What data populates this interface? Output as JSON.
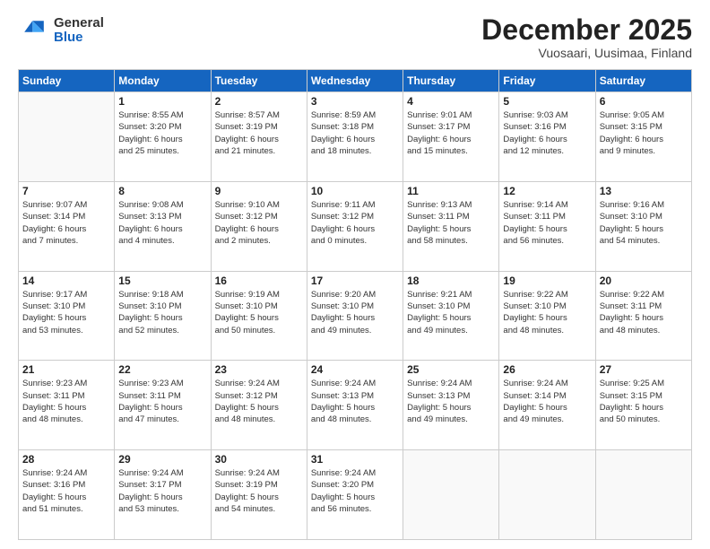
{
  "header": {
    "logo_line1": "General",
    "logo_line2": "Blue",
    "title": "December 2025",
    "subtitle": "Vuosaari, Uusimaa, Finland"
  },
  "weekdays": [
    "Sunday",
    "Monday",
    "Tuesday",
    "Wednesday",
    "Thursday",
    "Friday",
    "Saturday"
  ],
  "weeks": [
    [
      {
        "day": "",
        "info": ""
      },
      {
        "day": "1",
        "info": "Sunrise: 8:55 AM\nSunset: 3:20 PM\nDaylight: 6 hours\nand 25 minutes."
      },
      {
        "day": "2",
        "info": "Sunrise: 8:57 AM\nSunset: 3:19 PM\nDaylight: 6 hours\nand 21 minutes."
      },
      {
        "day": "3",
        "info": "Sunrise: 8:59 AM\nSunset: 3:18 PM\nDaylight: 6 hours\nand 18 minutes."
      },
      {
        "day": "4",
        "info": "Sunrise: 9:01 AM\nSunset: 3:17 PM\nDaylight: 6 hours\nand 15 minutes."
      },
      {
        "day": "5",
        "info": "Sunrise: 9:03 AM\nSunset: 3:16 PM\nDaylight: 6 hours\nand 12 minutes."
      },
      {
        "day": "6",
        "info": "Sunrise: 9:05 AM\nSunset: 3:15 PM\nDaylight: 6 hours\nand 9 minutes."
      }
    ],
    [
      {
        "day": "7",
        "info": "Sunrise: 9:07 AM\nSunset: 3:14 PM\nDaylight: 6 hours\nand 7 minutes."
      },
      {
        "day": "8",
        "info": "Sunrise: 9:08 AM\nSunset: 3:13 PM\nDaylight: 6 hours\nand 4 minutes."
      },
      {
        "day": "9",
        "info": "Sunrise: 9:10 AM\nSunset: 3:12 PM\nDaylight: 6 hours\nand 2 minutes."
      },
      {
        "day": "10",
        "info": "Sunrise: 9:11 AM\nSunset: 3:12 PM\nDaylight: 6 hours\nand 0 minutes."
      },
      {
        "day": "11",
        "info": "Sunrise: 9:13 AM\nSunset: 3:11 PM\nDaylight: 5 hours\nand 58 minutes."
      },
      {
        "day": "12",
        "info": "Sunrise: 9:14 AM\nSunset: 3:11 PM\nDaylight: 5 hours\nand 56 minutes."
      },
      {
        "day": "13",
        "info": "Sunrise: 9:16 AM\nSunset: 3:10 PM\nDaylight: 5 hours\nand 54 minutes."
      }
    ],
    [
      {
        "day": "14",
        "info": "Sunrise: 9:17 AM\nSunset: 3:10 PM\nDaylight: 5 hours\nand 53 minutes."
      },
      {
        "day": "15",
        "info": "Sunrise: 9:18 AM\nSunset: 3:10 PM\nDaylight: 5 hours\nand 52 minutes."
      },
      {
        "day": "16",
        "info": "Sunrise: 9:19 AM\nSunset: 3:10 PM\nDaylight: 5 hours\nand 50 minutes."
      },
      {
        "day": "17",
        "info": "Sunrise: 9:20 AM\nSunset: 3:10 PM\nDaylight: 5 hours\nand 49 minutes."
      },
      {
        "day": "18",
        "info": "Sunrise: 9:21 AM\nSunset: 3:10 PM\nDaylight: 5 hours\nand 49 minutes."
      },
      {
        "day": "19",
        "info": "Sunrise: 9:22 AM\nSunset: 3:10 PM\nDaylight: 5 hours\nand 48 minutes."
      },
      {
        "day": "20",
        "info": "Sunrise: 9:22 AM\nSunset: 3:11 PM\nDaylight: 5 hours\nand 48 minutes."
      }
    ],
    [
      {
        "day": "21",
        "info": "Sunrise: 9:23 AM\nSunset: 3:11 PM\nDaylight: 5 hours\nand 48 minutes."
      },
      {
        "day": "22",
        "info": "Sunrise: 9:23 AM\nSunset: 3:11 PM\nDaylight: 5 hours\nand 47 minutes."
      },
      {
        "day": "23",
        "info": "Sunrise: 9:24 AM\nSunset: 3:12 PM\nDaylight: 5 hours\nand 48 minutes."
      },
      {
        "day": "24",
        "info": "Sunrise: 9:24 AM\nSunset: 3:13 PM\nDaylight: 5 hours\nand 48 minutes."
      },
      {
        "day": "25",
        "info": "Sunrise: 9:24 AM\nSunset: 3:13 PM\nDaylight: 5 hours\nand 49 minutes."
      },
      {
        "day": "26",
        "info": "Sunrise: 9:24 AM\nSunset: 3:14 PM\nDaylight: 5 hours\nand 49 minutes."
      },
      {
        "day": "27",
        "info": "Sunrise: 9:25 AM\nSunset: 3:15 PM\nDaylight: 5 hours\nand 50 minutes."
      }
    ],
    [
      {
        "day": "28",
        "info": "Sunrise: 9:24 AM\nSunset: 3:16 PM\nDaylight: 5 hours\nand 51 minutes."
      },
      {
        "day": "29",
        "info": "Sunrise: 9:24 AM\nSunset: 3:17 PM\nDaylight: 5 hours\nand 53 minutes."
      },
      {
        "day": "30",
        "info": "Sunrise: 9:24 AM\nSunset: 3:19 PM\nDaylight: 5 hours\nand 54 minutes."
      },
      {
        "day": "31",
        "info": "Sunrise: 9:24 AM\nSunset: 3:20 PM\nDaylight: 5 hours\nand 56 minutes."
      },
      {
        "day": "",
        "info": ""
      },
      {
        "day": "",
        "info": ""
      },
      {
        "day": "",
        "info": ""
      }
    ]
  ]
}
